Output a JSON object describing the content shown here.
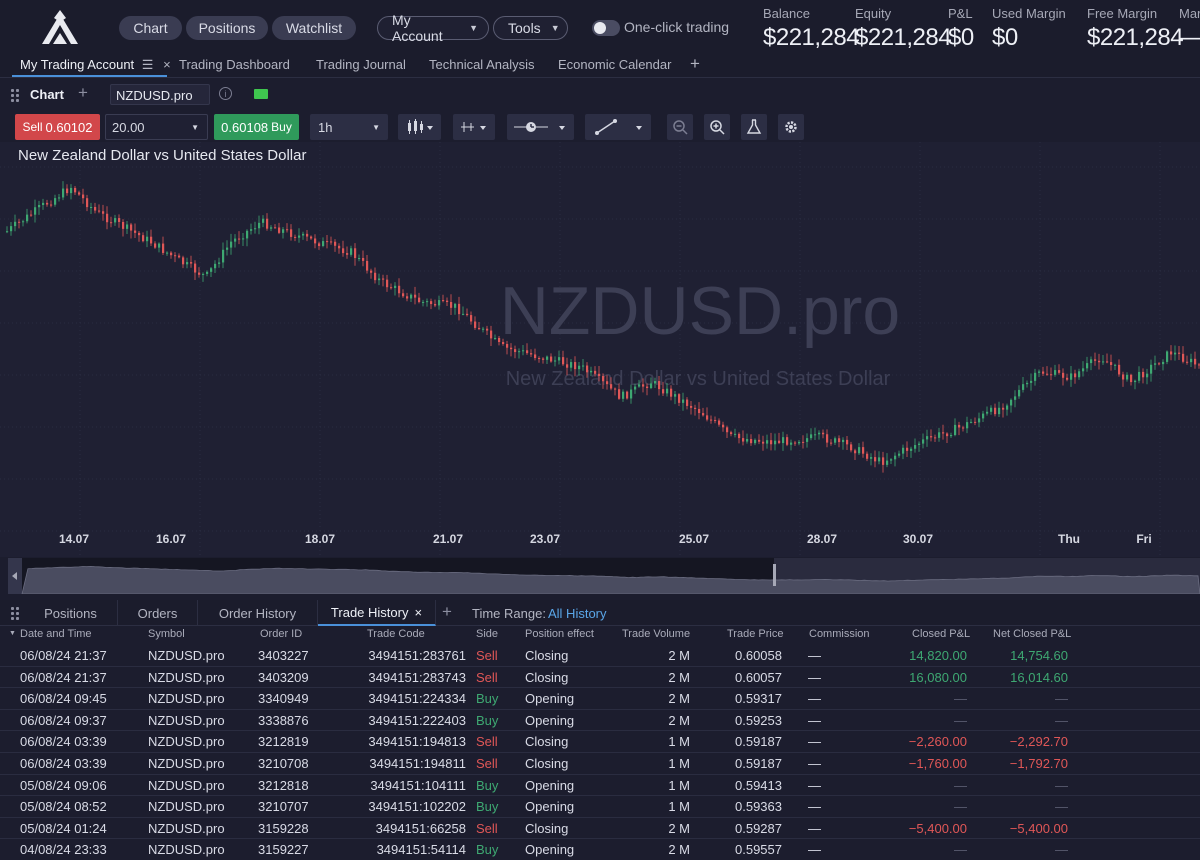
{
  "header": {
    "nav": [
      "Chart",
      "Positions",
      "Watchlist"
    ],
    "my_account": "My Account",
    "tools": "Tools",
    "one_click": "One-click trading",
    "stats": [
      {
        "label": "Balance",
        "value": "$221,284"
      },
      {
        "label": "Equity",
        "value": "$221,284"
      },
      {
        "label": "P&L",
        "value": "$0"
      },
      {
        "label": "Used Margin",
        "value": "$0"
      },
      {
        "label": "Free Margin",
        "value": "$221,284"
      },
      {
        "label": "Mar",
        "value": "—"
      }
    ]
  },
  "tabs": [
    "My Trading Account",
    "Trading Dashboard",
    "Trading Journal",
    "Technical Analysis",
    "Economic Calendar"
  ],
  "chart_header": {
    "label": "Chart",
    "symbol": "NZDUSD.pro"
  },
  "order": {
    "sell_label": "Sell",
    "sell_price": "0.60102",
    "quantity": "20.00",
    "buy_price": "0.60108",
    "buy_label": "Buy",
    "timeframe": "1h"
  },
  "chart": {
    "title": "New Zealand Dollar vs United States Dollar",
    "watermark_symbol": "NZDUSD.pro",
    "watermark_desc": "New Zealand Dollar vs United States Dollar",
    "x_labels": [
      "14.07",
      "16.07",
      "18.07",
      "21.07",
      "23.07",
      "25.07",
      "28.07",
      "30.07",
      "Thu",
      "Fri"
    ],
    "colors": {
      "up": "#3ea872",
      "down": "#e05757",
      "grid": "#2a2c40"
    }
  },
  "bottom": {
    "tabs": [
      "Positions",
      "Orders",
      "Order History",
      "Trade History"
    ],
    "time_range_label": "Time Range:",
    "time_range_value": "All History",
    "columns": [
      "Date and Time",
      "Symbol",
      "Order ID",
      "Trade Code",
      "Side",
      "Position effect",
      "Trade Volume",
      "Trade Price",
      "Commission",
      "Closed P&L",
      "Net Closed P&L"
    ],
    "rows": [
      {
        "date": "06/08/24 21:37",
        "symbol": "NZDUSD.pro",
        "order_id": "3403227",
        "code": "3494151:283761",
        "side": "Sell",
        "effect": "Closing",
        "volume": "2 M",
        "price": "0.60058",
        "commission": "—",
        "closed": "14,820.00",
        "net": "14,754.60"
      },
      {
        "date": "06/08/24 21:37",
        "symbol": "NZDUSD.pro",
        "order_id": "3403209",
        "code": "3494151:283743",
        "side": "Sell",
        "effect": "Closing",
        "volume": "2 M",
        "price": "0.60057",
        "commission": "—",
        "closed": "16,080.00",
        "net": "16,014.60"
      },
      {
        "date": "06/08/24 09:45",
        "symbol": "NZDUSD.pro",
        "order_id": "3340949",
        "code": "3494151:224334",
        "side": "Buy",
        "effect": "Opening",
        "volume": "2 M",
        "price": "0.59317",
        "commission": "—",
        "closed": "—",
        "net": "—"
      },
      {
        "date": "06/08/24 09:37",
        "symbol": "NZDUSD.pro",
        "order_id": "3338876",
        "code": "3494151:222403",
        "side": "Buy",
        "effect": "Opening",
        "volume": "2 M",
        "price": "0.59253",
        "commission": "—",
        "closed": "—",
        "net": "—"
      },
      {
        "date": "06/08/24 03:39",
        "symbol": "NZDUSD.pro",
        "order_id": "3212819",
        "code": "3494151:194813",
        "side": "Sell",
        "effect": "Closing",
        "volume": "1 M",
        "price": "0.59187",
        "commission": "—",
        "closed": "−2,260.00",
        "net": "−2,292.70"
      },
      {
        "date": "06/08/24 03:39",
        "symbol": "NZDUSD.pro",
        "order_id": "3210708",
        "code": "3494151:194811",
        "side": "Sell",
        "effect": "Closing",
        "volume": "1 M",
        "price": "0.59187",
        "commission": "—",
        "closed": "−1,760.00",
        "net": "−1,792.70"
      },
      {
        "date": "05/08/24 09:06",
        "symbol": "NZDUSD.pro",
        "order_id": "3212818",
        "code": "3494151:104111",
        "side": "Buy",
        "effect": "Opening",
        "volume": "1 M",
        "price": "0.59413",
        "commission": "—",
        "closed": "—",
        "net": "—"
      },
      {
        "date": "05/08/24 08:52",
        "symbol": "NZDUSD.pro",
        "order_id": "3210707",
        "code": "3494151:102202",
        "side": "Buy",
        "effect": "Opening",
        "volume": "1 M",
        "price": "0.59363",
        "commission": "—",
        "closed": "—",
        "net": "—"
      },
      {
        "date": "05/08/24 01:24",
        "symbol": "NZDUSD.pro",
        "order_id": "3159228",
        "code": "3494151:66258",
        "side": "Sell",
        "effect": "Closing",
        "volume": "2 M",
        "price": "0.59287",
        "commission": "—",
        "closed": "−5,400.00",
        "net": "−5,400.00"
      },
      {
        "date": "04/08/24 23:33",
        "symbol": "NZDUSD.pro",
        "order_id": "3159227",
        "code": "3494151:54114",
        "side": "Buy",
        "effect": "Opening",
        "volume": "2 M",
        "price": "0.59557",
        "commission": "—",
        "closed": "—",
        "net": "—"
      }
    ]
  }
}
